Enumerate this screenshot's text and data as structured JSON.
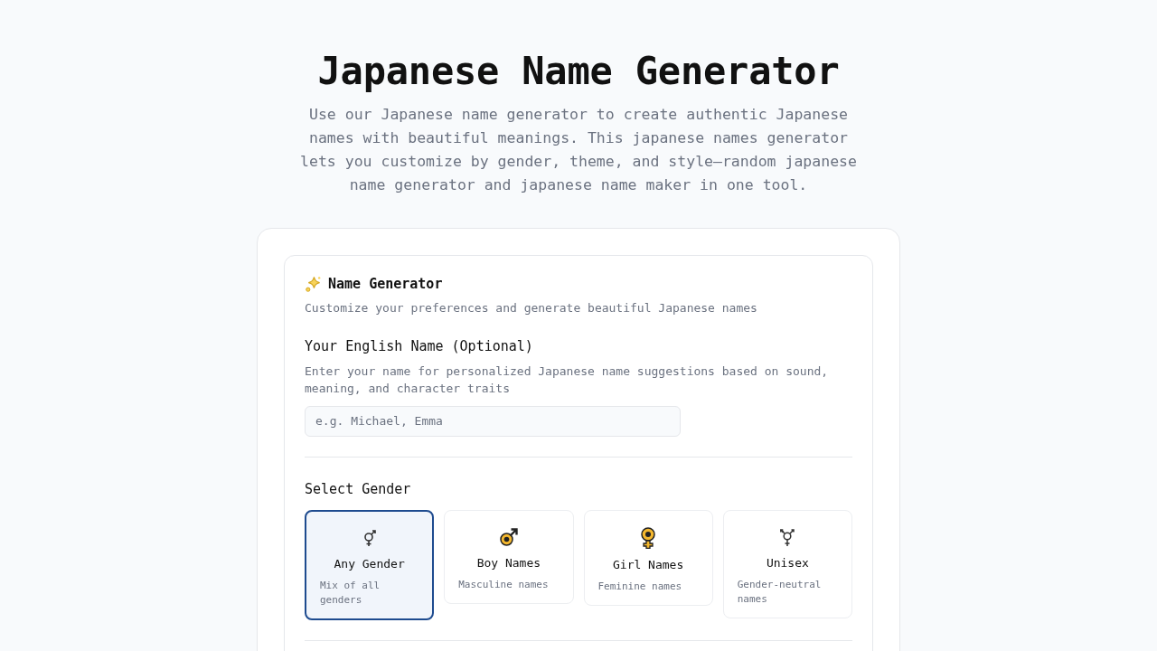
{
  "title": "Japanese Name Generator",
  "intro": "Use our Japanese name generator to create authentic Japanese names with beautiful meanings. This japanese names generator lets you customize by gender, theme, and style—random japanese name generator and japanese name maker in one tool.",
  "card": {
    "title": "Name Generator",
    "subtitle": "Customize your preferences and generate beautiful Japanese names"
  },
  "name_field": {
    "label": "Your English Name (Optional)",
    "help": "Enter your name for personalized Japanese name suggestions based on sound, meaning, and character traits",
    "placeholder": "e.g. Michael, Emma"
  },
  "gender": {
    "label": "Select Gender",
    "options": [
      {
        "kind": "any",
        "label": "Any Gender",
        "description": "Mix of all genders",
        "selected": true
      },
      {
        "kind": "boy",
        "label": "Boy Names",
        "description": "Masculine names",
        "selected": false
      },
      {
        "kind": "girl",
        "label": "Girl Names",
        "description": "Feminine names",
        "selected": false
      },
      {
        "kind": "unisex",
        "label": "Unisex",
        "description": "Gender-neutral names",
        "selected": false
      }
    ]
  }
}
